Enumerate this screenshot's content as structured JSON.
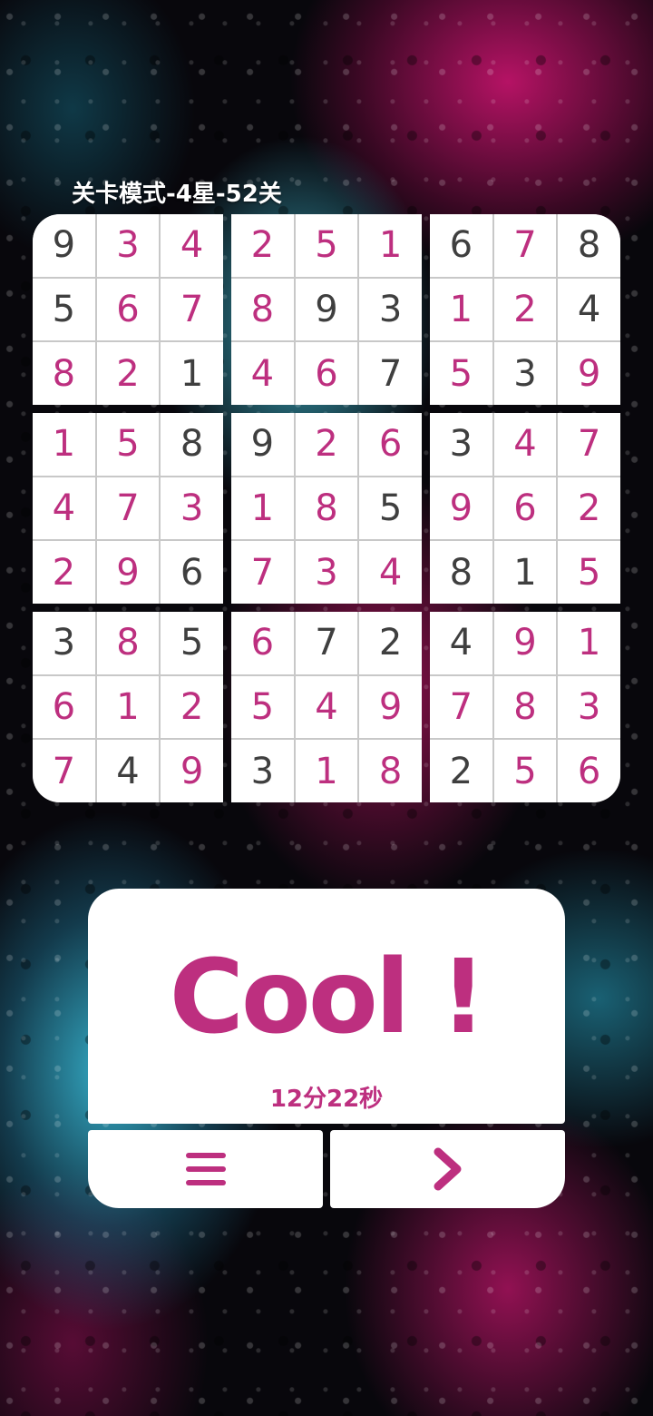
{
  "level_title": "关卡模式-4星-52关",
  "board": {
    "boxes": [
      [
        {
          "v": "9",
          "filled": false
        },
        {
          "v": "3",
          "filled": true
        },
        {
          "v": "4",
          "filled": true
        },
        {
          "v": "5",
          "filled": false
        },
        {
          "v": "6",
          "filled": true
        },
        {
          "v": "7",
          "filled": true
        },
        {
          "v": "8",
          "filled": true
        },
        {
          "v": "2",
          "filled": true
        },
        {
          "v": "1",
          "filled": false
        }
      ],
      [
        {
          "v": "2",
          "filled": true
        },
        {
          "v": "5",
          "filled": true
        },
        {
          "v": "1",
          "filled": true
        },
        {
          "v": "8",
          "filled": true
        },
        {
          "v": "9",
          "filled": false
        },
        {
          "v": "3",
          "filled": false
        },
        {
          "v": "4",
          "filled": true
        },
        {
          "v": "6",
          "filled": true
        },
        {
          "v": "7",
          "filled": false
        }
      ],
      [
        {
          "v": "6",
          "filled": false
        },
        {
          "v": "7",
          "filled": true
        },
        {
          "v": "8",
          "filled": false
        },
        {
          "v": "1",
          "filled": true
        },
        {
          "v": "2",
          "filled": true
        },
        {
          "v": "4",
          "filled": false
        },
        {
          "v": "5",
          "filled": true
        },
        {
          "v": "3",
          "filled": false
        },
        {
          "v": "9",
          "filled": true
        }
      ],
      [
        {
          "v": "1",
          "filled": true
        },
        {
          "v": "5",
          "filled": true
        },
        {
          "v": "8",
          "filled": false
        },
        {
          "v": "4",
          "filled": true
        },
        {
          "v": "7",
          "filled": true
        },
        {
          "v": "3",
          "filled": true
        },
        {
          "v": "2",
          "filled": true
        },
        {
          "v": "9",
          "filled": true
        },
        {
          "v": "6",
          "filled": false
        }
      ],
      [
        {
          "v": "9",
          "filled": false
        },
        {
          "v": "2",
          "filled": true
        },
        {
          "v": "6",
          "filled": true
        },
        {
          "v": "1",
          "filled": true
        },
        {
          "v": "8",
          "filled": true
        },
        {
          "v": "5",
          "filled": false
        },
        {
          "v": "7",
          "filled": true
        },
        {
          "v": "3",
          "filled": true
        },
        {
          "v": "4",
          "filled": true
        }
      ],
      [
        {
          "v": "3",
          "filled": false
        },
        {
          "v": "4",
          "filled": true
        },
        {
          "v": "7",
          "filled": true
        },
        {
          "v": "9",
          "filled": true
        },
        {
          "v": "6",
          "filled": true
        },
        {
          "v": "2",
          "filled": true
        },
        {
          "v": "8",
          "filled": false
        },
        {
          "v": "1",
          "filled": false
        },
        {
          "v": "5",
          "filled": true
        }
      ],
      [
        {
          "v": "3",
          "filled": false
        },
        {
          "v": "8",
          "filled": true
        },
        {
          "v": "5",
          "filled": false
        },
        {
          "v": "6",
          "filled": true
        },
        {
          "v": "1",
          "filled": true
        },
        {
          "v": "2",
          "filled": true
        },
        {
          "v": "7",
          "filled": true
        },
        {
          "v": "4",
          "filled": false
        },
        {
          "v": "9",
          "filled": true
        }
      ],
      [
        {
          "v": "6",
          "filled": true
        },
        {
          "v": "7",
          "filled": false
        },
        {
          "v": "2",
          "filled": false
        },
        {
          "v": "5",
          "filled": true
        },
        {
          "v": "4",
          "filled": true
        },
        {
          "v": "9",
          "filled": true
        },
        {
          "v": "3",
          "filled": false
        },
        {
          "v": "1",
          "filled": true
        },
        {
          "v": "8",
          "filled": true
        }
      ],
      [
        {
          "v": "4",
          "filled": false
        },
        {
          "v": "9",
          "filled": true
        },
        {
          "v": "1",
          "filled": true
        },
        {
          "v": "7",
          "filled": true
        },
        {
          "v": "8",
          "filled": true
        },
        {
          "v": "3",
          "filled": true
        },
        {
          "v": "2",
          "filled": false
        },
        {
          "v": "5",
          "filled": true
        },
        {
          "v": "6",
          "filled": true
        }
      ]
    ]
  },
  "result": {
    "message": "Cool !",
    "time": "12分22秒"
  },
  "buttons": {
    "menu_icon": "menu-icon",
    "next_icon": "chevron-right-icon"
  },
  "colors": {
    "accent": "#bd2f7f",
    "given_digit": "#3f3f3f",
    "cell_bg": "#ffffff",
    "grid_line": "#c8c8c8"
  }
}
